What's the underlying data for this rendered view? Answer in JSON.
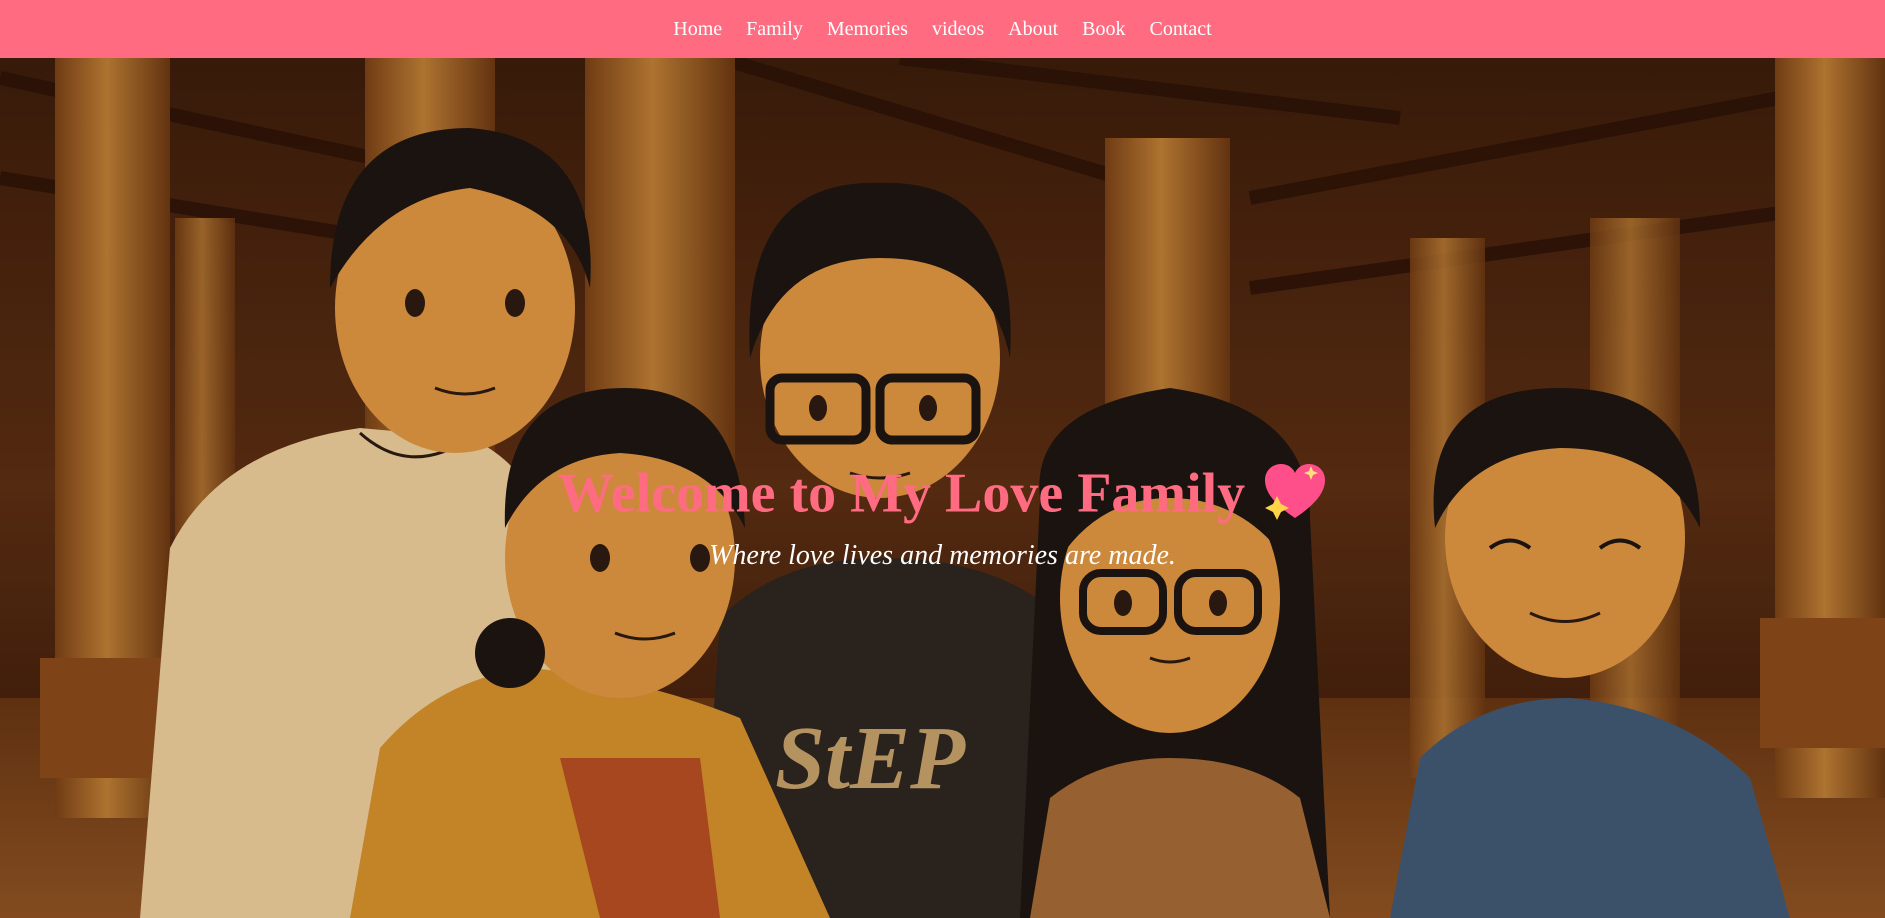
{
  "nav": {
    "items": [
      {
        "label": "Home"
      },
      {
        "label": "Family"
      },
      {
        "label": "Memories"
      },
      {
        "label": "videos"
      },
      {
        "label": "About"
      },
      {
        "label": "Book"
      },
      {
        "label": "Contact"
      }
    ]
  },
  "hero": {
    "title": "Welcome to My Love Family",
    "title_icon": "sparkling-heart-icon",
    "subtitle": "Where love lives and memories are made."
  },
  "colors": {
    "nav_background": "#ff6b81",
    "title": "#ff6b81",
    "subtitle": "#ffffff"
  }
}
